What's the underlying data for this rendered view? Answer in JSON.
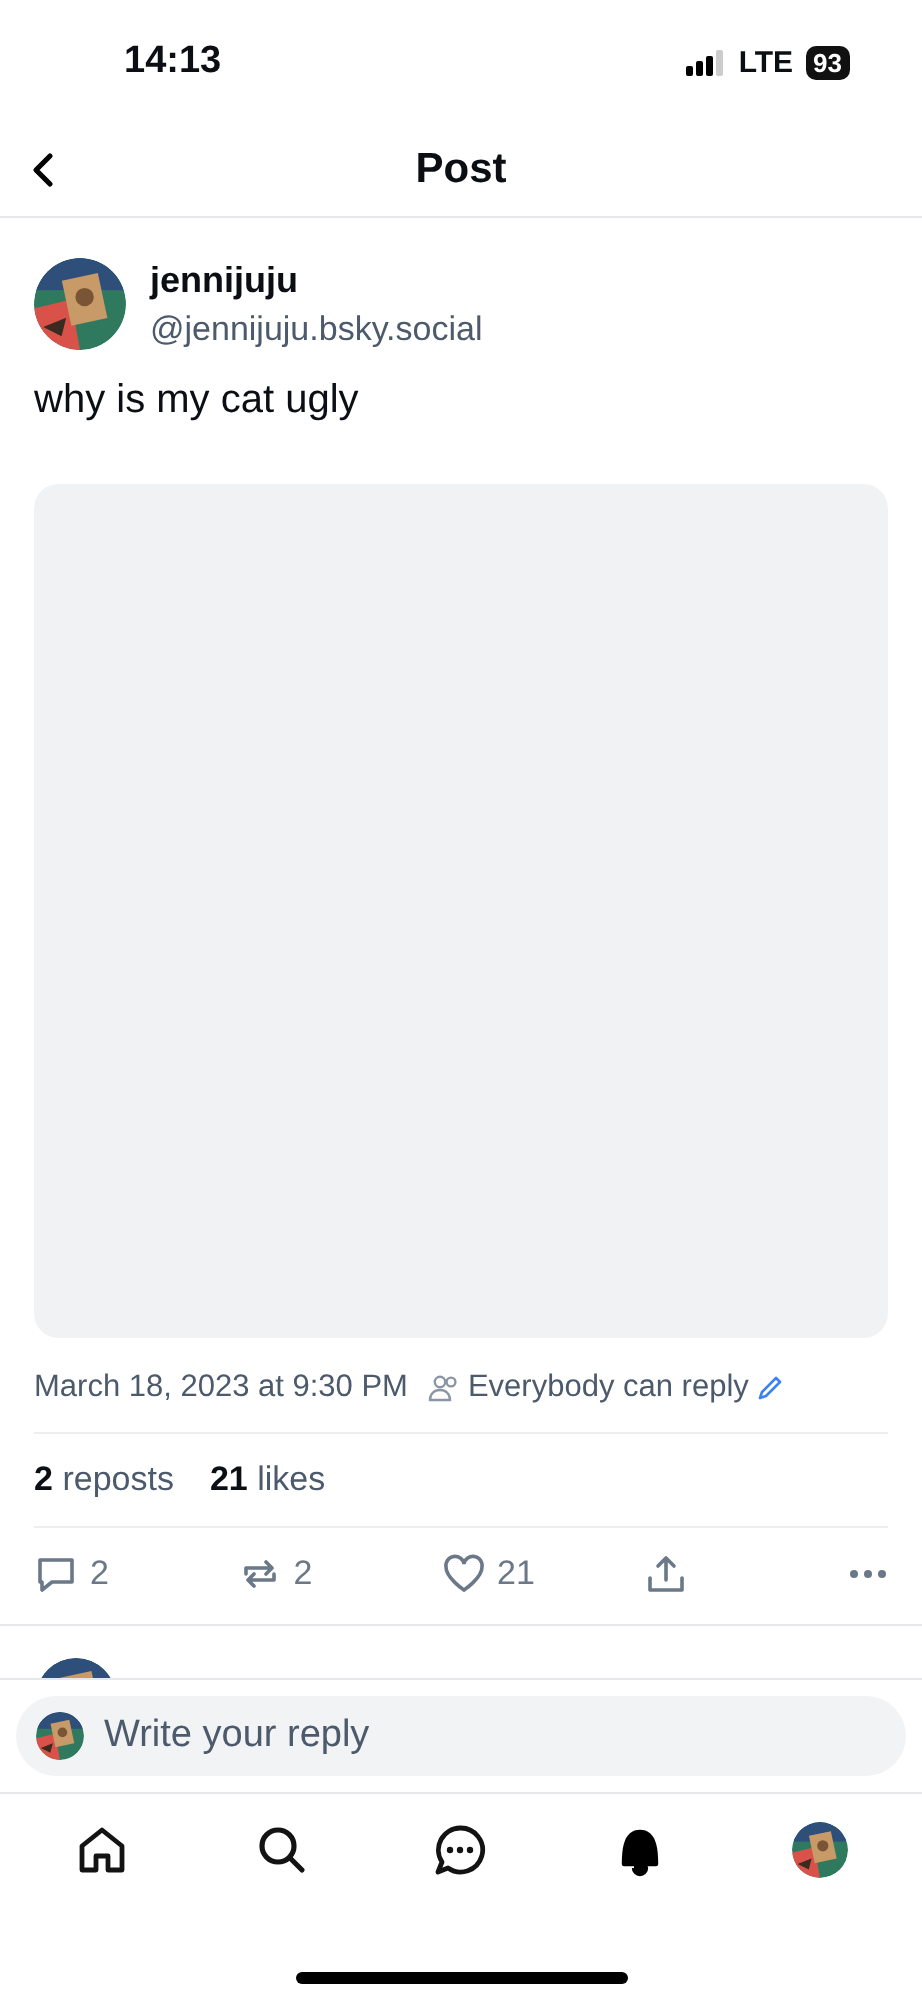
{
  "status_bar": {
    "time": "14:13",
    "network": "LTE",
    "battery": "93"
  },
  "header": {
    "title": "Post"
  },
  "post": {
    "author": {
      "name": "jennijuju",
      "handle": "@jennijuju.bsky.social"
    },
    "text": "why is my cat ugly",
    "timestamp": "March 18, 2023 at 9:30 PM",
    "reply_setting": "Everybody can reply",
    "stats": [
      {
        "count": "2",
        "label": "reposts"
      },
      {
        "count": "21",
        "label": "likes"
      }
    ],
    "actions": [
      {
        "kind": "reply",
        "count": "2"
      },
      {
        "kind": "repost",
        "count": "2"
      },
      {
        "kind": "like",
        "count": "21"
      },
      {
        "kind": "share"
      },
      {
        "kind": "more"
      }
    ]
  },
  "composer": {
    "placeholder": "Write your reply"
  },
  "nav": [
    {
      "kind": "home",
      "selected": false
    },
    {
      "kind": "search",
      "selected": false
    },
    {
      "kind": "chat",
      "selected": false
    },
    {
      "kind": "notifications",
      "selected": true
    },
    {
      "kind": "profile",
      "selected": false
    }
  ]
}
